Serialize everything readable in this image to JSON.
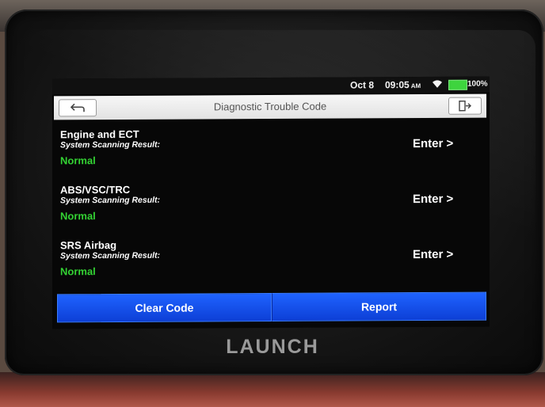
{
  "brand": "LAUNCH",
  "status_bar": {
    "date": "Oct 8",
    "time": "09:05",
    "ampm": "AM",
    "battery": "100%",
    "battery_level": 1.0
  },
  "header": {
    "title": "Diagnostic Trouble Code",
    "back_icon": "back-arrow-icon",
    "exit_icon": "exit-icon"
  },
  "systems": [
    {
      "name": "Engine and ECT",
      "label": "System Scanning Result:",
      "status": "Normal",
      "action": "Enter >"
    },
    {
      "name": "ABS/VSC/TRC",
      "label": "System Scanning Result:",
      "status": "Normal",
      "action": "Enter >"
    },
    {
      "name": "SRS Airbag",
      "label": "System Scanning Result:",
      "status": "Normal",
      "action": "Enter >"
    }
  ],
  "footer": {
    "clear_label": "Clear Code",
    "report_label": "Report"
  },
  "colors": {
    "normal_status": "#33d233",
    "button_blue": "#1f63ff",
    "battery": "#3ed43e"
  }
}
